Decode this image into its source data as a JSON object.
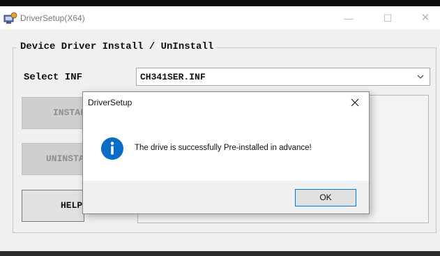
{
  "window": {
    "title": "DriverSetup(X64)",
    "min_glyph": "—",
    "max_glyph": "☐",
    "close_glyph": "✕"
  },
  "group": {
    "title": "Device Driver Install / UnInstall"
  },
  "inf": {
    "label": "Select INF",
    "selected": "CH341SER.INF"
  },
  "buttons": {
    "install": "INSTALL",
    "uninstall": "UNINSTALL",
    "help": "HELP"
  },
  "dialog": {
    "title": "DriverSetup",
    "message": "The drive is successfully Pre-installed in advance!",
    "ok_label": "OK",
    "icon": "info-icon"
  },
  "colors": {
    "accent": "#0078d7",
    "info_icon": "#0a6cc7"
  }
}
